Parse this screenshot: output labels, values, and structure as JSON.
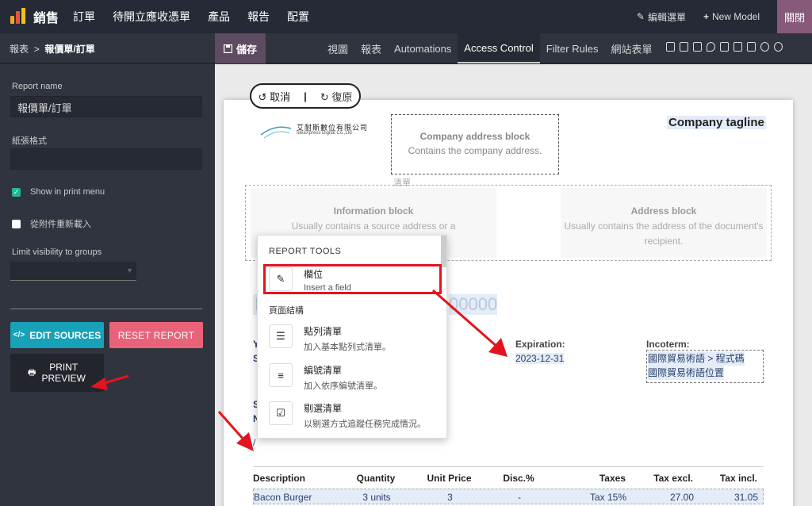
{
  "navbar": {
    "app_title": "銷售",
    "menu": [
      "訂單",
      "待開立應收憑單",
      "產品",
      "報告",
      "配置"
    ],
    "edit_menu": "編輯選單",
    "new_model": "New Model",
    "close": "關閉"
  },
  "breadcrumb": {
    "parent": "報表",
    "separator": ">",
    "current": "報價單/訂單"
  },
  "save_label": "儲存",
  "tabs": [
    {
      "label": "視圖",
      "active": false
    },
    {
      "label": "報表",
      "active": false
    },
    {
      "label": "Automations",
      "active": false
    },
    {
      "label": "Access Control",
      "active": true
    },
    {
      "label": "Filter Rules",
      "active": false
    },
    {
      "label": "網站表單",
      "active": false
    }
  ],
  "view_icons": [
    "form-view-icon",
    "list-view-icon",
    "kanban-view-icon",
    "map-view-icon",
    "calendar-view-icon",
    "graph-view-icon",
    "pivot-view-icon",
    "activity-view-icon",
    "search-view-icon"
  ],
  "sidebar": {
    "report_name_label": "Report name",
    "report_name_value": "報價單/訂單",
    "paper_format_label": "紙張格式",
    "paper_format_value": "",
    "show_in_print_label": "Show in print menu",
    "show_in_print_checked": true,
    "reload_attachment_label": "從附件重新載入",
    "reload_attachment_checked": false,
    "groups_label": "Limit visibility to groups",
    "edit_sources": "EDIT SOURCES",
    "reset_report": "RESET REPORT",
    "print_preview": "PRINT PREVIEW"
  },
  "editor": {
    "undo": "取消",
    "redo": "復原",
    "company_logo_cn": "艾耐斯數位有限公司",
    "company_logo_en": "IdeaXpress Digital Co.,Ltd",
    "company_address_title": "Company address block",
    "company_address_desc": "Contains the company address.",
    "company_tagline": "Company tagline",
    "ghost_label": "清單",
    "info_block_title": "Information block",
    "info_block_desc": "Usually contains a source address or a",
    "address_block_title": "Address block",
    "address_block_desc": "Usually contains the address of the document's recipient.",
    "doc_title_fragment": "I",
    "doc_number_fragment": "00000",
    "expiration_label": "Expiration:",
    "expiration_value": "2023-12-31",
    "incoterm_label": "Incoterm:",
    "incoterm_line1": "國際貿易術語 > 程式碼",
    "incoterm_line2": "國際貿易術語位置",
    "frag_y": "Y",
    "frag_s1": "S",
    "frag_s2": "S",
    "frag_n": "N",
    "frag_slash": "/"
  },
  "table": {
    "headers": [
      "Description",
      "Quantity",
      "Unit Price",
      "Disc.%",
      "Taxes",
      "Tax excl.",
      "Tax incl."
    ],
    "rows": [
      [
        "Bacon Burger",
        "3 units",
        "3",
        "-",
        "Tax 15%",
        "27.00",
        "31.05"
      ]
    ]
  },
  "report_tools": {
    "title": "REPORT TOOLS",
    "field_title": "欄位",
    "field_desc": "Insert a field",
    "section": "頁面結構",
    "items": [
      {
        "title": "點列清單",
        "desc": "加入基本點列式清單。",
        "icon": "bullet-list-icon"
      },
      {
        "title": "編號清單",
        "desc": "加入依序編號清單。",
        "icon": "numbered-list-icon"
      },
      {
        "title": "剔選清單",
        "desc": "以剔選方式追蹤任務完成情況。",
        "icon": "checklist-icon"
      }
    ]
  },
  "colors": {
    "navbar": "#262a36",
    "sidebar": "#30343e",
    "brand": "#875a7b",
    "edit_sources": "#17a2b8",
    "reset_report": "#e8637a",
    "annotation": "#e3141e",
    "checkbox_on": "#21b799"
  }
}
